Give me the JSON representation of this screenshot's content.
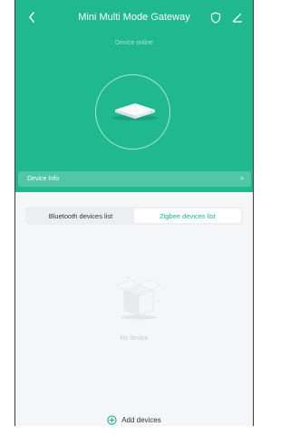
{
  "header": {
    "title": "Mini Multi Mode Gateway",
    "status": "Device online"
  },
  "device_info": {
    "label": "Device Info",
    "chevron": ">"
  },
  "tabs": [
    {
      "label": "Bluetooth devices list",
      "active": false
    },
    {
      "label": "Zigbee devices list",
      "active": true
    }
  ],
  "empty_state": {
    "text": "No device"
  },
  "footer": {
    "add_label": "Add devices"
  },
  "colors": {
    "accent": "#20b88f",
    "tab_active_text": "#1fb58a"
  },
  "icons": [
    "back-icon",
    "shield-icon",
    "edit-icon",
    "gateway-device-image",
    "empty-box-illustration",
    "add-circle-icon"
  ]
}
